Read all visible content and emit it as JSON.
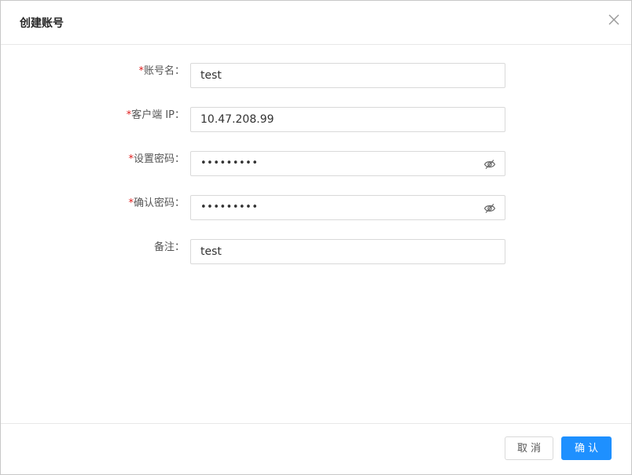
{
  "dialog": {
    "title": "创建账号",
    "close_icon": "close-icon"
  },
  "form": {
    "required_mark": "*",
    "account_name": {
      "label": "账号名：",
      "value": "test"
    },
    "client_ip": {
      "label": "客户端 IP：",
      "value": "10.47.208.99"
    },
    "set_password": {
      "label": "设置密码：",
      "value": "•••••••••",
      "icon": "eye-hidden-icon"
    },
    "confirm_password": {
      "label": "确认密码：",
      "value": "•••••••••",
      "icon": "eye-hidden-icon"
    },
    "remark": {
      "label": "备注：",
      "value": "test"
    }
  },
  "footer": {
    "cancel_label": "取消",
    "ok_label": "确认",
    "primary_color": "#1e90ff"
  }
}
